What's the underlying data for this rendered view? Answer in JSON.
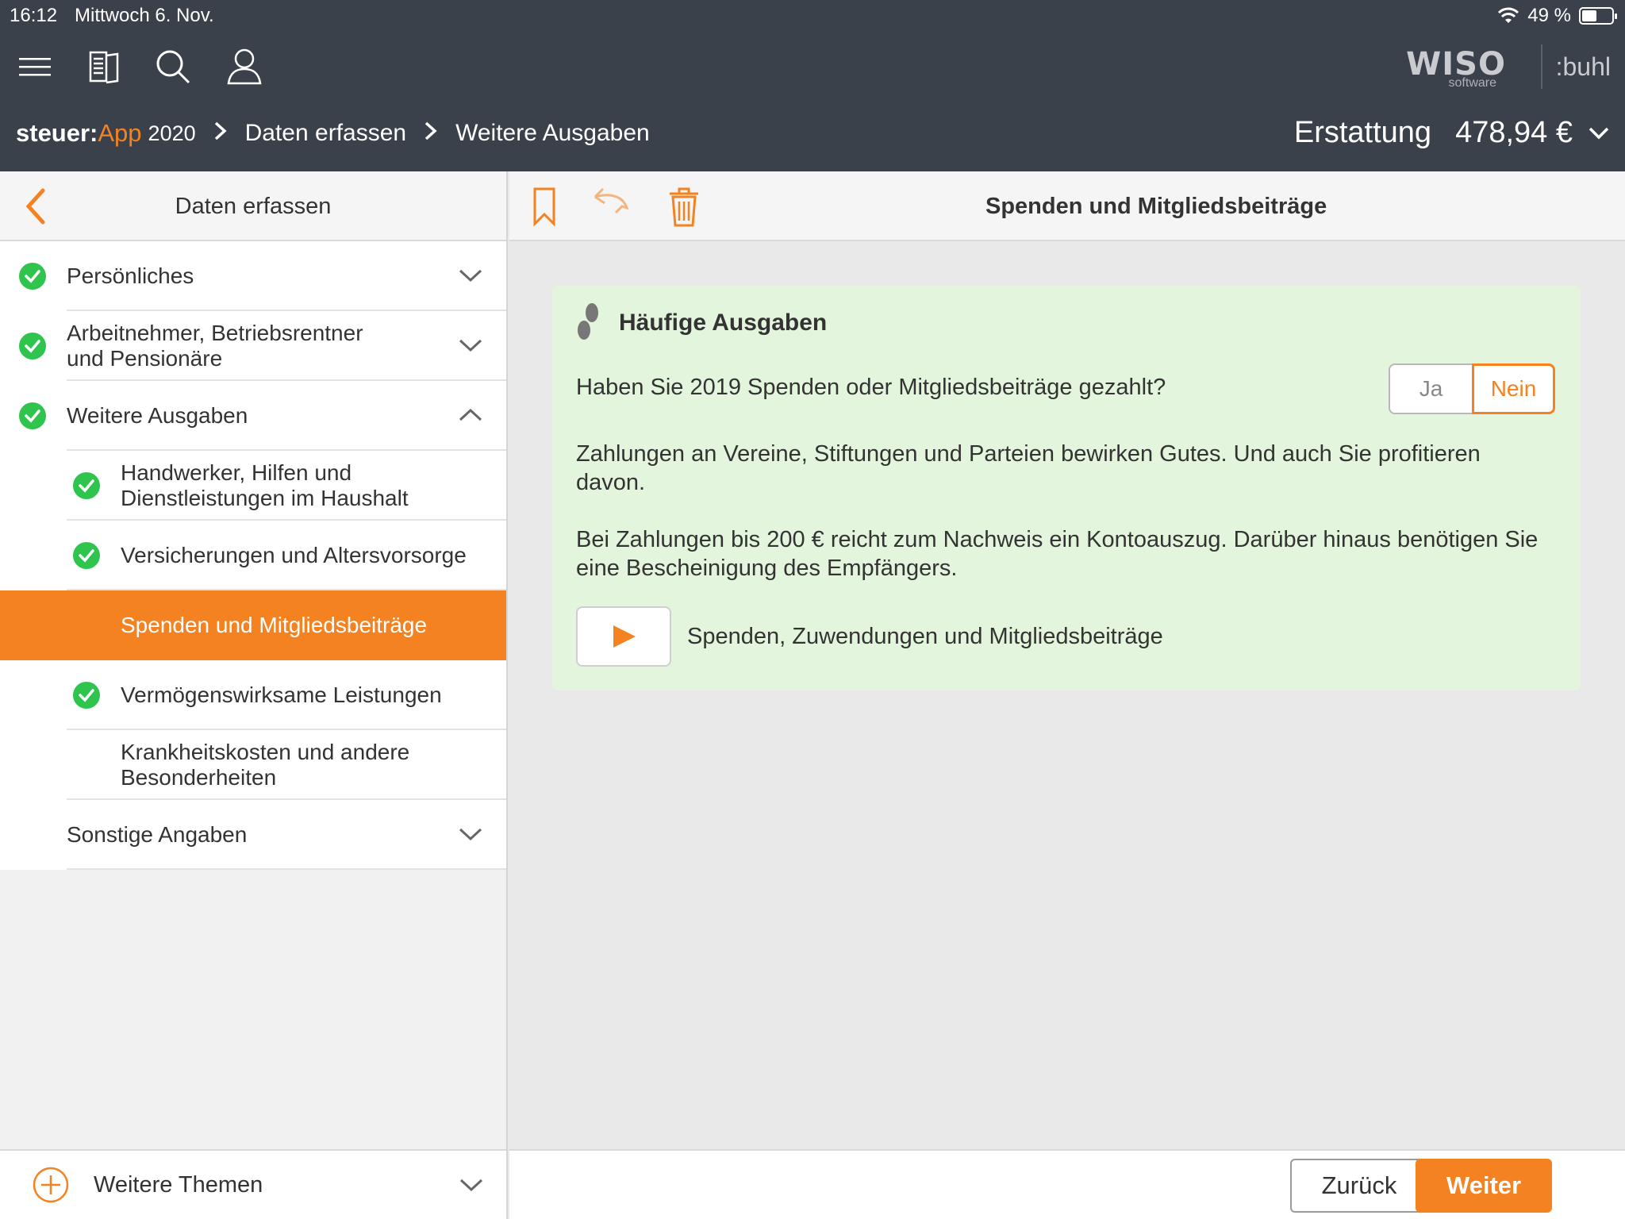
{
  "status": {
    "time": "16:12",
    "date": "Mittwoch 6. Nov.",
    "battery": "49 %",
    "battery_level": 0.49
  },
  "branding": {
    "wiso": "WISO",
    "wiso_sub": "software",
    "buhl": ":buhl"
  },
  "breadcrumb": {
    "brand_prefix": "steuer:",
    "brand_app": "App",
    "year": "2020",
    "items": [
      "Daten erfassen",
      "Weitere Ausgaben"
    ]
  },
  "refund": {
    "label": "Erstattung",
    "amount": "478,94 €"
  },
  "left_panel": {
    "title": "Daten erfassen",
    "items": [
      {
        "label": "Persönliches",
        "checked": true,
        "level": 0,
        "chevron": "down"
      },
      {
        "label": "Arbeitnehmer, Betriebsrentner\nund Pensionäre",
        "checked": true,
        "level": 0,
        "chevron": "down"
      },
      {
        "label": "Weitere Ausgaben",
        "checked": true,
        "level": 0,
        "chevron": "up"
      },
      {
        "label": "Handwerker, Hilfen und\nDienstleistungen im Haushalt",
        "checked": true,
        "level": 1
      },
      {
        "label": "Versicherungen und Altersvorsorge",
        "checked": true,
        "level": 1
      },
      {
        "label": "Spenden und Mitgliedsbeiträge",
        "checked": false,
        "level": 1,
        "active": true
      },
      {
        "label": "Vermögenswirksame Leistungen",
        "checked": true,
        "level": 1
      },
      {
        "label": "Krankheitskosten und andere\nBesonderheiten",
        "checked": false,
        "level": 1
      },
      {
        "label": "Sonstige Angaben",
        "checked": false,
        "level": 0,
        "chevron": "down"
      }
    ],
    "bottom_label": "Weitere Themen"
  },
  "main": {
    "title": "Spenden und Mitgliedsbeiträge",
    "card": {
      "title": "Häufige Ausgaben",
      "question": "Haben Sie 2019 Spenden oder Mitgliedsbeiträge gezahlt?",
      "option_yes": "Ja",
      "option_no": "Nein",
      "selected": "Nein",
      "paragraph1": "Zahlungen an Vereine, Stiftungen und Parteien bewirken Gutes. Und auch Sie profitieren davon.",
      "paragraph2": "Bei Zahlungen bis 200 € reicht zum Nachweis ein Kontoauszug. Darüber hinaus benötigen Sie eine Bescheinigung des Empfängers.",
      "video_label": "Spenden, Zuwendungen und Mitgliedsbeiträge"
    },
    "back_label": "Zurück",
    "next_label": "Weiter"
  },
  "colors": {
    "accent": "#f58220",
    "header": "#3a414b",
    "check": "#2ec44e",
    "card": "#e3f5dc"
  }
}
